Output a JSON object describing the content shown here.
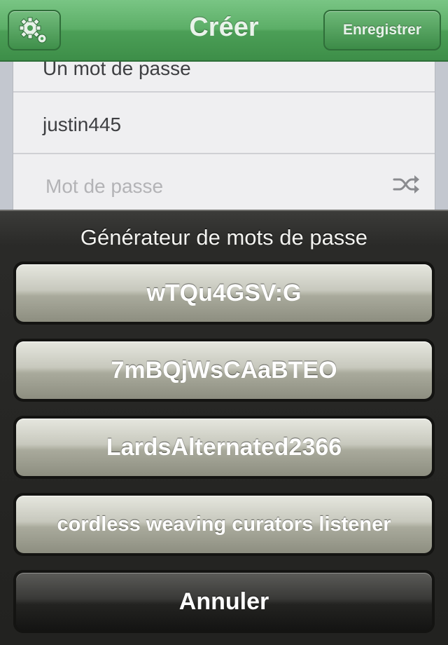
{
  "navbar": {
    "title": "Créer",
    "save_label": "Enregistrer",
    "settings_icon": "gear-icon"
  },
  "form": {
    "rows": [
      {
        "text": "Un mot de passe",
        "placeholder": false
      },
      {
        "text": "justin445",
        "placeholder": false
      },
      {
        "text": "Mot de passe",
        "placeholder": true
      }
    ],
    "generate_icon": "shuffle-icon"
  },
  "action_sheet": {
    "title": "Générateur de mots de passe",
    "options": [
      "wTQu4GSV:G",
      "7mBQjWsCAaBTEO",
      "LardsAlternated2366",
      "cordless weaving curators listener"
    ],
    "cancel_label": "Annuler"
  },
  "colors": {
    "nav_green": "#4c9f57",
    "sheet_dark": "#2a2a28",
    "option_light": "#c7c8bd"
  }
}
